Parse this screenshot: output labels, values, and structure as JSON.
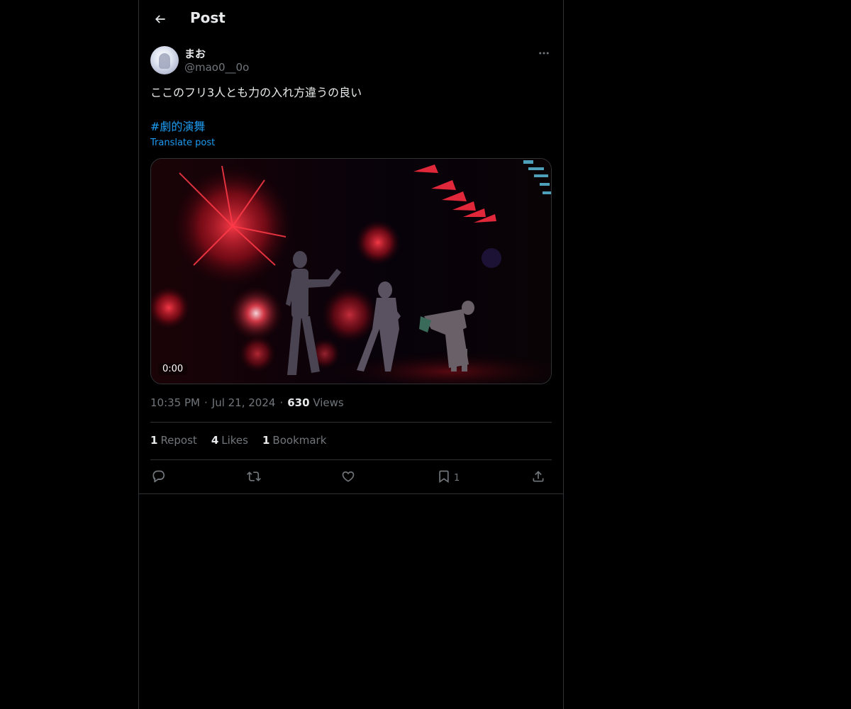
{
  "header": {
    "title": "Post",
    "back_icon": "arrow-left-icon"
  },
  "author": {
    "display_name": "まお",
    "handle": "@mao0__0o",
    "more_icon": "more-horizontal-icon"
  },
  "post": {
    "text": "ここのフリ3人とも力の入れ方違うの良い",
    "hashtag": "#劇的演舞",
    "translate_label": "Translate post"
  },
  "media": {
    "type": "video",
    "time": "0:00"
  },
  "meta": {
    "time": "10:35 PM",
    "separator": "·",
    "date": "Jul 21, 2024",
    "views_count": "630",
    "views_label": "Views"
  },
  "stats": {
    "reposts_count": "1",
    "reposts_label": "Repost",
    "likes_count": "4",
    "likes_label": "Likes",
    "bookmarks_count": "1",
    "bookmarks_label": "Bookmark"
  },
  "actions": {
    "reply_icon": "reply-icon",
    "repost_icon": "repost-icon",
    "like_icon": "heart-icon",
    "bookmark_icon": "bookmark-icon",
    "bookmark_count": "1",
    "share_icon": "share-icon"
  },
  "colors": {
    "background": "#000000",
    "text": "#e7e9ea",
    "muted": "#71767b",
    "link": "#1d9bf0",
    "border": "#2f3336"
  }
}
